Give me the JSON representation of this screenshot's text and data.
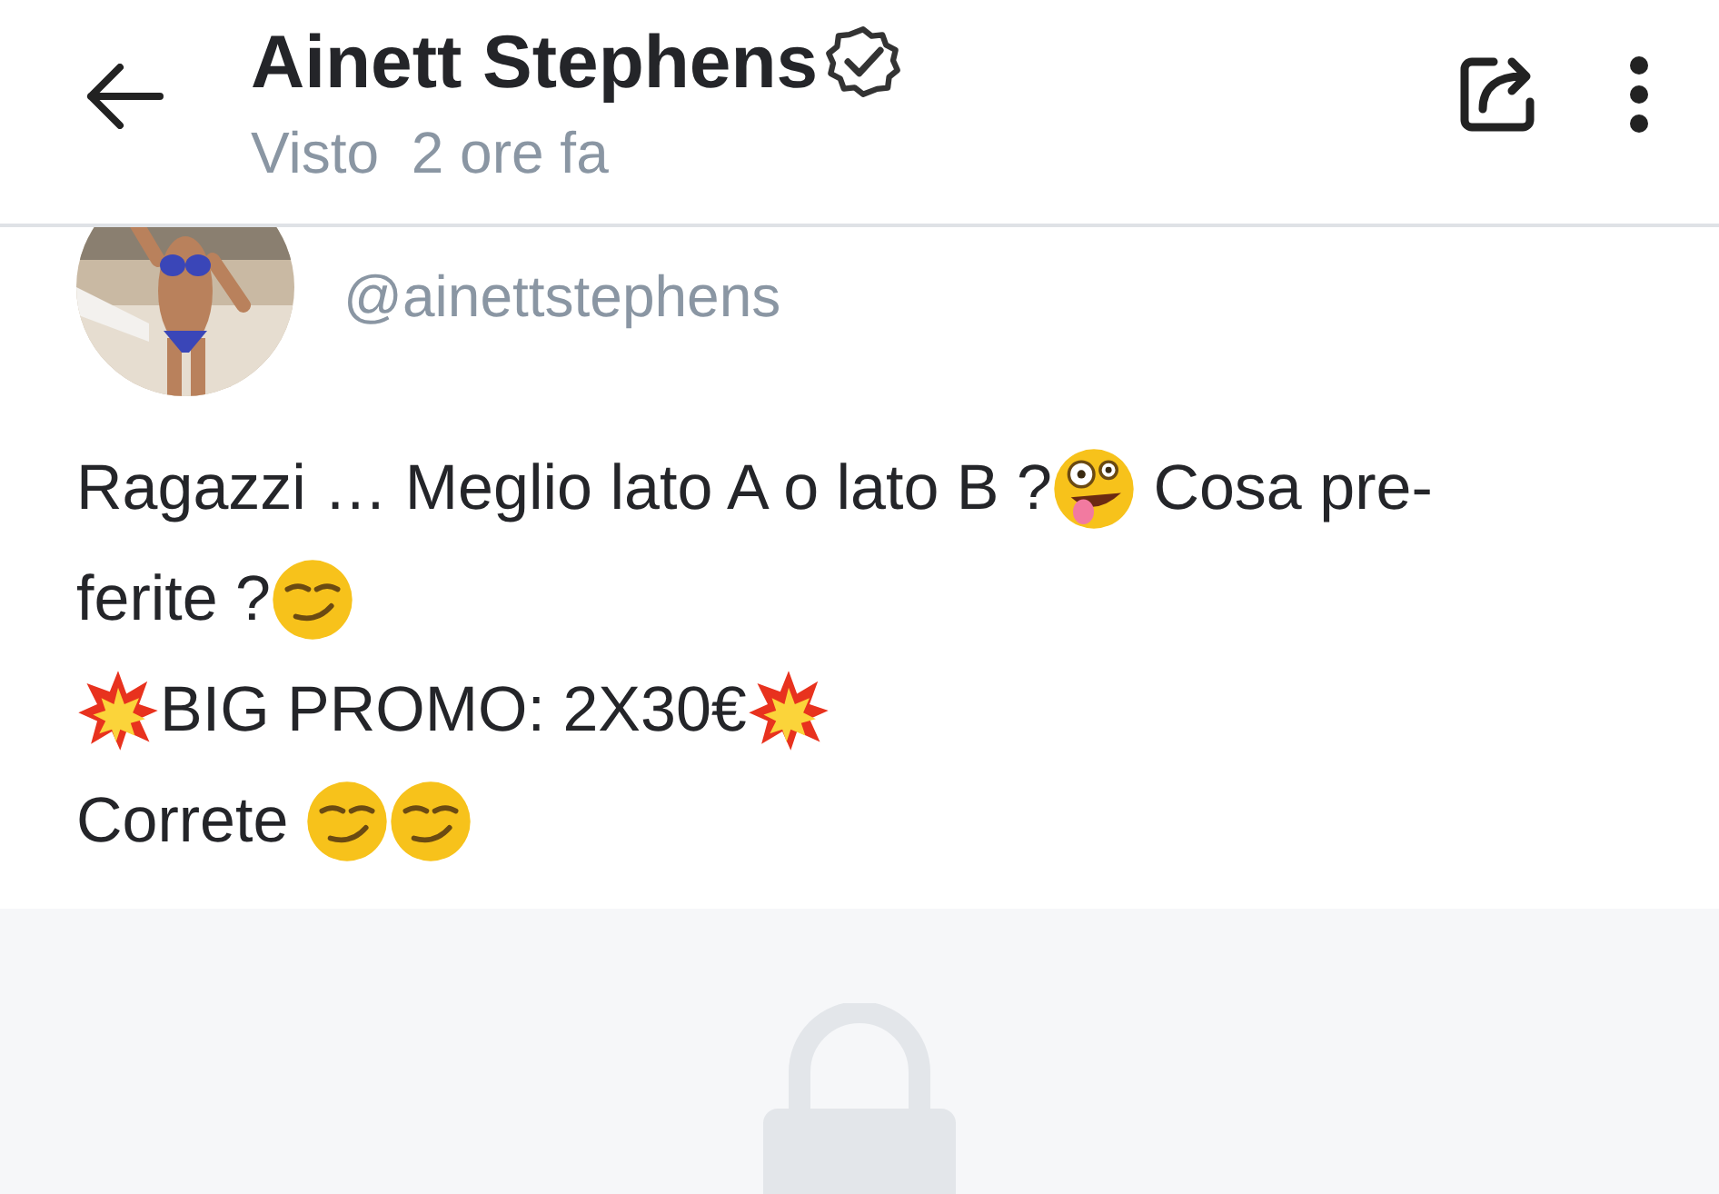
{
  "header": {
    "title": "Ainett Stephens",
    "verified": true,
    "status": "Visto  2 ore fa"
  },
  "post": {
    "avatar": {
      "kind": "picture"
    },
    "handle": "@ainettstephens",
    "lines": [
      [
        {
          "kind": "text",
          "text": "Ragazzi … Meglio lato A o lato B ?"
        },
        {
          "kind": "zany-emoji"
        },
        {
          "kind": "text",
          "text": " Cosa pre-"
        }
      ],
      [
        {
          "kind": "text",
          "text": "ferite ?"
        },
        {
          "kind": "smirk-emoji"
        }
      ],
      [
        {
          "kind": "collision-emoji"
        },
        {
          "kind": "text",
          "text": "BIG PROMO: 2X30€"
        },
        {
          "kind": "collision-emoji"
        }
      ],
      [
        {
          "kind": "text",
          "text": "Correte "
        },
        {
          "kind": "smirk-emoji"
        },
        {
          "kind": "smirk-emoji"
        }
      ]
    ]
  },
  "locked": true
}
